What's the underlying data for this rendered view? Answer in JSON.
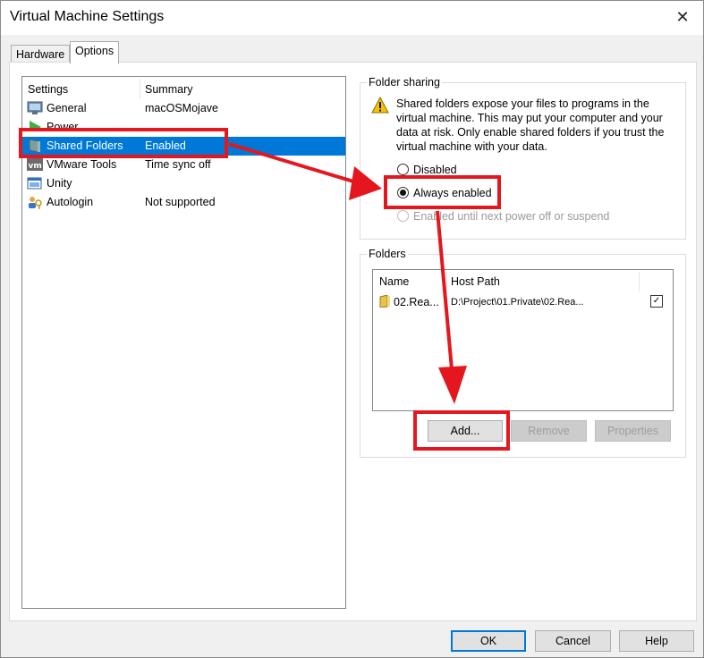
{
  "window": {
    "title": "Virtual Machine Settings",
    "close_glyph": "✕"
  },
  "tabs": [
    {
      "label": "Hardware"
    },
    {
      "label": "Options"
    }
  ],
  "settings_list": {
    "headers": {
      "settings": "Settings",
      "summary": "Summary"
    },
    "items": [
      {
        "name": "General",
        "summary": "macOSMojave",
        "icon": "monitor-icon"
      },
      {
        "name": "Power",
        "summary": "",
        "icon": "power-play-icon"
      },
      {
        "name": "Shared Folders",
        "summary": "Enabled",
        "icon": "shared-folder-icon",
        "selected": true
      },
      {
        "name": "VMware Tools",
        "summary": "Time sync off",
        "icon": "vmware-tools-icon"
      },
      {
        "name": "Unity",
        "summary": "",
        "icon": "unity-window-icon"
      },
      {
        "name": "Autologin",
        "summary": "Not supported",
        "icon": "users-key-icon"
      }
    ]
  },
  "folder_sharing": {
    "title": "Folder sharing",
    "warning": "Shared folders expose your files to programs in the virtual machine. This may put your computer and your data at risk. Only enable shared folders if you trust the virtual machine with your data.",
    "options": [
      {
        "label": "Disabled",
        "checked": false,
        "disabled": false
      },
      {
        "label": "Always enabled",
        "checked": true,
        "disabled": false
      },
      {
        "label": "Enabled until next power off or suspend",
        "checked": false,
        "disabled": true
      }
    ]
  },
  "folders": {
    "title": "Folders",
    "headers": {
      "name": "Name",
      "host_path": "Host Path"
    },
    "rows": [
      {
        "name": "02.Rea...",
        "host_path": "D:\\Project\\01.Private\\02.Rea...",
        "enabled": true
      }
    ],
    "buttons": {
      "add": "Add...",
      "remove": "Remove",
      "properties": "Properties"
    }
  },
  "footer": {
    "ok": "OK",
    "cancel": "Cancel",
    "help": "Help"
  },
  "colors": {
    "selection": "#0078d7",
    "highlight": "#e4171f",
    "warning": "#f5c400"
  }
}
